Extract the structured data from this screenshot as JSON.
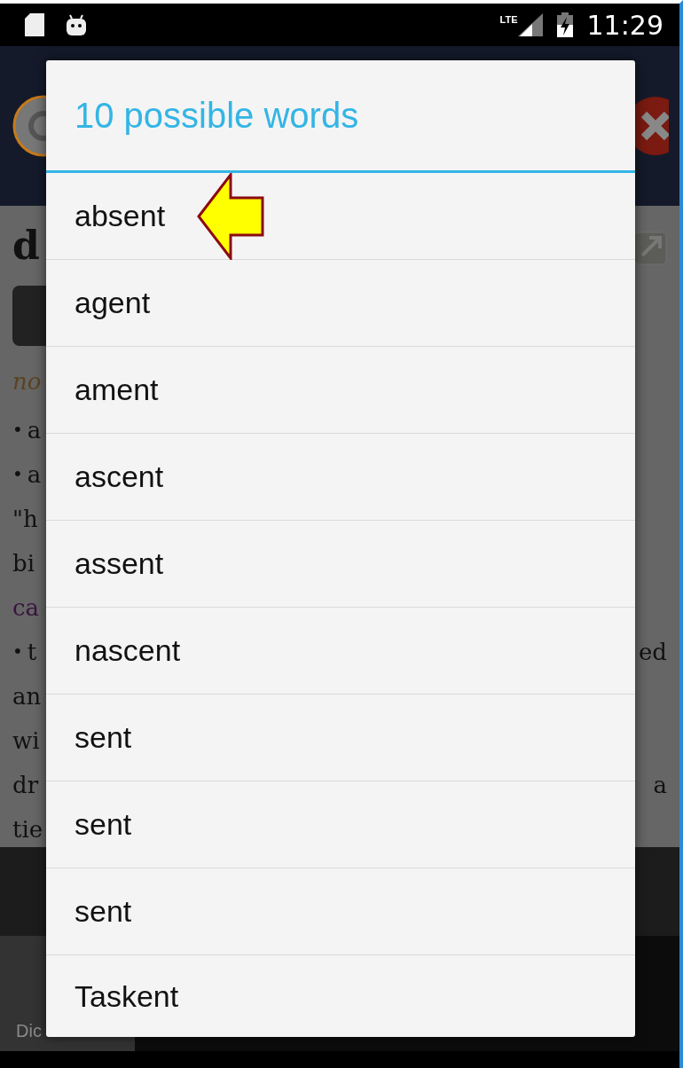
{
  "status_bar": {
    "time": "11:29",
    "network": "LTE"
  },
  "background": {
    "heading": "d",
    "tag": "no",
    "lines": [
      {
        "kind": "bullet",
        "bullet": "•",
        "left": "a"
      },
      {
        "kind": "bullet",
        "bullet": "•",
        "left": "a"
      },
      {
        "kind": "plain",
        "left": "\"h"
      },
      {
        "kind": "plain",
        "left": "bi"
      },
      {
        "kind": "link",
        "left": "ca"
      },
      {
        "kind": "bullet",
        "bullet": "•",
        "left": "t",
        "right": "ed"
      },
      {
        "kind": "plain",
        "left": "an"
      },
      {
        "kind": "plain",
        "left": "wi"
      },
      {
        "kind": "plain",
        "left": "dr",
        "right": "a"
      },
      {
        "kind": "plain",
        "left": "tie"
      }
    ],
    "bottom_tab": "Dic"
  },
  "dialog": {
    "title": "10 possible words",
    "items": [
      {
        "label": "absent",
        "pointed": true
      },
      {
        "label": "agent",
        "pointed": false
      },
      {
        "label": "ament",
        "pointed": false
      },
      {
        "label": "ascent",
        "pointed": false
      },
      {
        "label": "assent",
        "pointed": false
      },
      {
        "label": "nascent",
        "pointed": false
      },
      {
        "label": "sent",
        "pointed": false
      },
      {
        "label": "sent",
        "pointed": false
      },
      {
        "label": "sent",
        "pointed": false
      },
      {
        "label": "Taskent",
        "pointed": false
      }
    ]
  }
}
